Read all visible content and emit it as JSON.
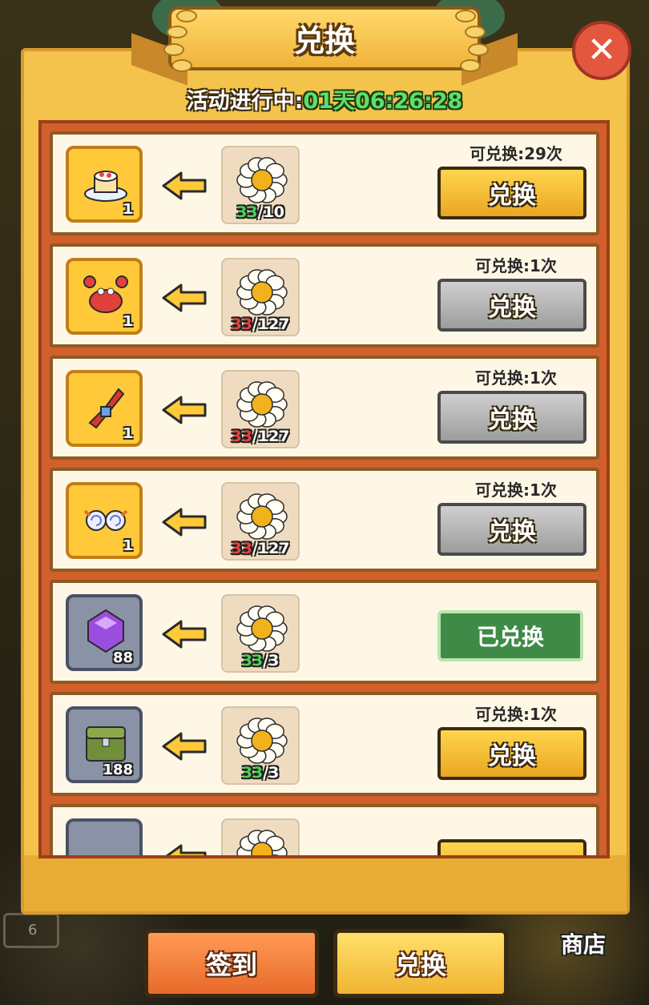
{
  "dialog": {
    "title": "兑换",
    "timer_label": "活动进行中:",
    "timer_value": "01天06:26:28",
    "close_icon": "close-x-icon"
  },
  "rows": [
    {
      "reward_icon": "cake-icon",
      "reward_count": "1",
      "reward_bg": "gold",
      "cost_have": "33",
      "cost_need": "/10",
      "cost_state": "ok",
      "limit": "可兑换:29次",
      "button": "兑换",
      "button_style": "yellow",
      "redeemed": false
    },
    {
      "reward_icon": "crab-icon",
      "reward_count": "1",
      "reward_bg": "gold",
      "cost_have": "33",
      "cost_need": "/127",
      "cost_state": "no",
      "limit": "可兑换:1次",
      "button": "兑换",
      "button_style": "gray",
      "redeemed": false
    },
    {
      "reward_icon": "claw-weapon-icon",
      "reward_count": "1",
      "reward_bg": "gold",
      "cost_have": "33",
      "cost_need": "/127",
      "cost_state": "no",
      "limit": "可兑换:1次",
      "button": "兑换",
      "button_style": "gray",
      "redeemed": false
    },
    {
      "reward_icon": "spiral-glasses-icon",
      "reward_count": "1",
      "reward_bg": "gold",
      "cost_have": "33",
      "cost_need": "/127",
      "cost_state": "no",
      "limit": "可兑换:1次",
      "button": "兑换",
      "button_style": "gray",
      "redeemed": false
    },
    {
      "reward_icon": "purple-gem-icon",
      "reward_count": "88",
      "reward_bg": "gray",
      "cost_have": "33",
      "cost_need": "/3",
      "cost_state": "ok",
      "limit": "",
      "button": "已兑换",
      "button_style": "green",
      "redeemed": true
    },
    {
      "reward_icon": "green-chest-icon",
      "reward_count": "188",
      "reward_bg": "gray",
      "cost_have": "33",
      "cost_need": "/3",
      "cost_state": "ok",
      "limit": "可兑换:1次",
      "button": "兑换",
      "button_style": "yellow",
      "redeemed": false
    }
  ],
  "bottom_tabs": {
    "signin": "签到",
    "exchange": "兑换"
  },
  "shop_label": "商店",
  "side_slot_value": "6",
  "colors": {
    "panel": "#f3c34c",
    "list_bg": "#d1602d",
    "ok": "#49d35a",
    "insufficient": "#e54040",
    "redeemed": "#3f8a47"
  }
}
